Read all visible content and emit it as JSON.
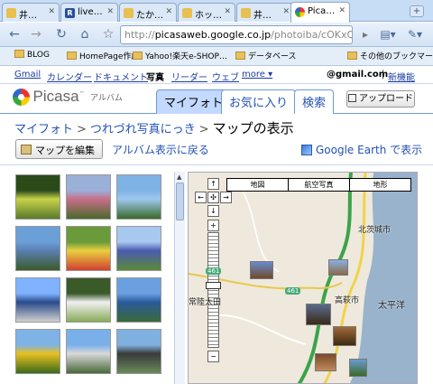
{
  "browser": {
    "tabs": [
      {
        "label": "井…",
        "icon": "folder-icon",
        "active": false
      },
      {
        "label": "live…",
        "icon": "r-logo-icon",
        "active": false
      },
      {
        "label": "たか…",
        "icon": "folder-icon",
        "active": false
      },
      {
        "label": "ホッ…",
        "icon": "folder-icon",
        "active": false
      },
      {
        "label": "井…",
        "icon": "folder-icon",
        "active": false
      },
      {
        "label": "Pica…",
        "icon": "picasa-icon",
        "active": true
      }
    ],
    "url_prefix": "http://",
    "url_host": "picasaweb.google.co.jp",
    "url_path": "/photoiba/cOKxQH/ph",
    "bookmarks": [
      "BLOG",
      "HomePage作成",
      "Yahoo!楽天e-SHOP…",
      "データベース"
    ],
    "other_bookmarks": "その他のブックマーク"
  },
  "gbar": {
    "links": [
      "Gmail",
      "カレンダー",
      "ドキュメント",
      "写真",
      "リーダー",
      "ウェブ",
      "more ▾"
    ],
    "account": "@gmail.com",
    "separator": "|",
    "new_link": "新機能"
  },
  "picasa": {
    "logo_name": "Picasa",
    "logo_sub": "アルバム",
    "tabs": [
      "マイフォト",
      "お気に入り",
      "検索"
    ],
    "active_tab": 0,
    "upload": "アップロード"
  },
  "breadcrumb": {
    "items": [
      "マイフォト",
      "つれづれ写真にっき"
    ],
    "separator": ">",
    "current": "マップの表示"
  },
  "actions": {
    "edit_map": "マップを編集",
    "album_view": "アルバム表示に戻る",
    "google_earth": "Google Earth で表示"
  },
  "thumbnails": [
    {
      "name": "flowers-field",
      "colors": [
        "#2b4a1a",
        "#c8d34a",
        "#5a7a2a"
      ]
    },
    {
      "name": "pink-trees",
      "colors": [
        "#9bb0d8",
        "#c86e8a",
        "#4a6a2a"
      ]
    },
    {
      "name": "tree-sky",
      "colors": [
        "#7fb2e5",
        "#9ec7ee",
        "#3a6a2a"
      ]
    },
    {
      "name": "lake-shore",
      "colors": [
        "#6b9fd8",
        "#5a7fb0",
        "#3b5a2a"
      ]
    },
    {
      "name": "tulip-garden",
      "colors": [
        "#6a9a3a",
        "#e8d040",
        "#d04030"
      ]
    },
    {
      "name": "blue-flowers",
      "colors": [
        "#a7c8ef",
        "#4a5ab0",
        "#5a8a3a"
      ]
    },
    {
      "name": "bridge-sea",
      "colors": [
        "#7fb2ff",
        "#2a4a8a",
        "#d0d0d0"
      ]
    },
    {
      "name": "white-flower",
      "colors": [
        "#3a5a2a",
        "#f0f0f0",
        "#8aaa5a"
      ]
    },
    {
      "name": "tower-sky",
      "colors": [
        "#6aa0e0",
        "#2a5a9a",
        "#3a6a3a"
      ]
    },
    {
      "name": "sunflowers",
      "colors": [
        "#7fb2e5",
        "#e8c020",
        "#3a6a1a"
      ]
    },
    {
      "name": "museum",
      "colors": [
        "#7ab0ea",
        "#d8d8d8",
        "#4a6a3a"
      ]
    },
    {
      "name": "dark-building",
      "colors": [
        "#7fb0e0",
        "#3a3a3a",
        "#6a8a5a"
      ]
    }
  ],
  "map": {
    "types": [
      "地図",
      "航空写真",
      "地形"
    ],
    "controls": {
      "up": "↑",
      "down": "↓",
      "left": "←",
      "right": "→",
      "center": "✣",
      "zoom_in": "+",
      "zoom_out": "−"
    },
    "labels": {
      "kitaibaraki": "北茨城市",
      "takahagi": "高萩市",
      "pacific": "太平洋",
      "hitachiomiya": "常陸太田"
    },
    "routes": [
      "461",
      "461"
    ]
  }
}
